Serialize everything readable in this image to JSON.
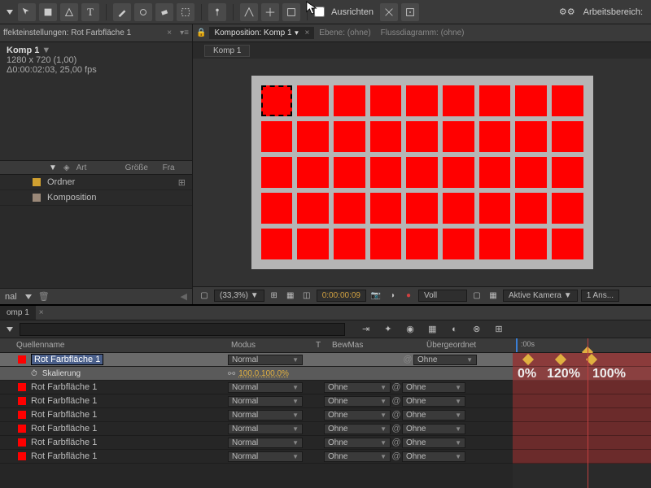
{
  "toolbar": {
    "align_label": "Ausrichten",
    "workspace_label": "Arbeitsbereich:"
  },
  "effect_panel": {
    "title": "ffekteinstellungen: Rot Farbfläche 1"
  },
  "project": {
    "name": "Komp 1",
    "dims": "1280 x 720 (1,00)",
    "duration": "Δ0:00:02:03, 25,00 fps",
    "col_name": "Art",
    "col_size": "Größe",
    "col_fr": "Fra",
    "items": [
      {
        "label": "Ordner",
        "color": "#d0a030"
      },
      {
        "label": "Komposition",
        "color": "#9a8878"
      }
    ],
    "footer_nal": "nal"
  },
  "comp_tabs": {
    "active": "Komposition: Komp 1",
    "ebene": "Ebene: (ohne)",
    "fluss": "Flussdiagramm: (ohne)",
    "sub": "Komp 1"
  },
  "viewer_footer": {
    "zoom": "(33,3%)",
    "timecode": "0:00:00:09",
    "render": "Voll",
    "camera": "Aktive Kamera",
    "views": "1 Ans..."
  },
  "timeline": {
    "tab": "omp 1",
    "col_source": "Quellenname",
    "col_mode": "Modus",
    "col_t": "T",
    "col_bew": "BewMas",
    "col_parent": "Übergeordnet",
    "layer_name": "Rot Farbfläche 1",
    "mode_normal": "Normal",
    "bew_ohne": "Ohne",
    "parent_ohne": "Ohne",
    "prop_scale": "Skalierung",
    "prop_scale_value": "100,0,100,0%",
    "time_tick": ":00s",
    "keyframes": {
      "pct": [
        "0%",
        "120%",
        "100%"
      ]
    }
  }
}
